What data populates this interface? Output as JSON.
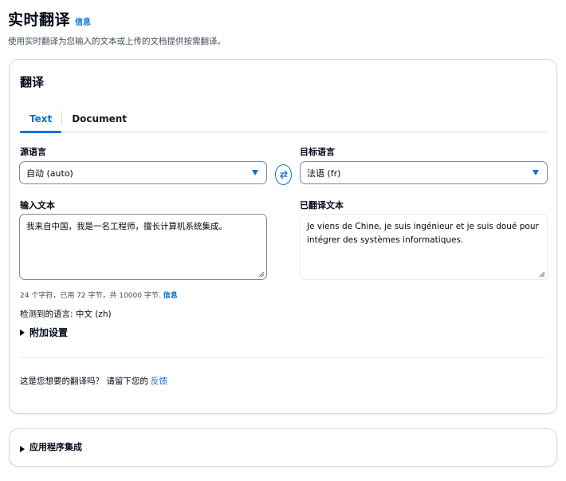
{
  "header": {
    "title": "实时翻译",
    "info_label": "信息",
    "description": "使用实时翻译为您输入的文本或上传的文档提供按需翻译。"
  },
  "translate_card": {
    "title": "翻译",
    "tabs": [
      {
        "label": "Text",
        "active": true
      },
      {
        "label": "Document",
        "active": false
      }
    ],
    "source_language": {
      "label": "源语言",
      "selected": "自动 (auto)"
    },
    "target_language": {
      "label": "目标语言",
      "selected": "法语 (fr)"
    },
    "swap_icon": "swap-arrows-icon",
    "input_text": {
      "label": "输入文本",
      "value": "我来自中国，我是一名工程师，擅长计算机系统集成。"
    },
    "translated_text": {
      "label": "已翻译文本",
      "value": "Je viens de Chine, je suis ingénieur et je suis doué pour intégrer des systèmes informatiques."
    },
    "char_hint": "24 个字符，已用 72 字节，共 10000 字节.",
    "char_hint_info": "信息",
    "detected_language": "检测到的语言: 中文 (zh)",
    "additional_settings": "附加设置",
    "feedback_prompt": "这是您想要的翻译吗？ 请留下您的",
    "feedback_link": "反馈"
  },
  "integration_card": {
    "title": "应用程序集成"
  },
  "colors": {
    "accent": "#0972d3",
    "text": "#000716",
    "border": "#7d8998"
  }
}
